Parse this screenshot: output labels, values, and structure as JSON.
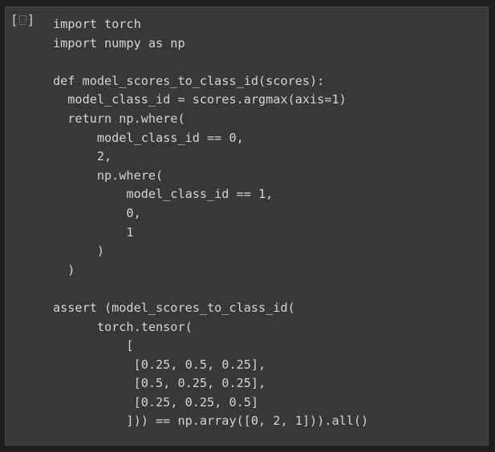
{
  "cell": {
    "run_indicator": {
      "open": "[",
      "close": "]",
      "icon": "cell-status-icon"
    },
    "code_lines": [
      "import torch",
      "import numpy as np",
      "",
      "def model_scores_to_class_id(scores):",
      "  model_class_id = scores.argmax(axis=1)",
      "  return np.where(",
      "      model_class_id == 0,",
      "      2,",
      "      np.where(",
      "          model_class_id == 1,",
      "          0,",
      "          1",
      "      )",
      "  )",
      "",
      "assert (model_scores_to_class_id(",
      "      torch.tensor(",
      "          [",
      "           [0.25, 0.5, 0.25],",
      "           [0.5, 0.25, 0.25],",
      "           [0.25, 0.25, 0.5]",
      "          ])) == np.array([0, 2, 1])).all()"
    ]
  },
  "colors": {
    "background": "#1e1e1e",
    "cell_background": "#383838",
    "text": "#d4d4d4"
  }
}
